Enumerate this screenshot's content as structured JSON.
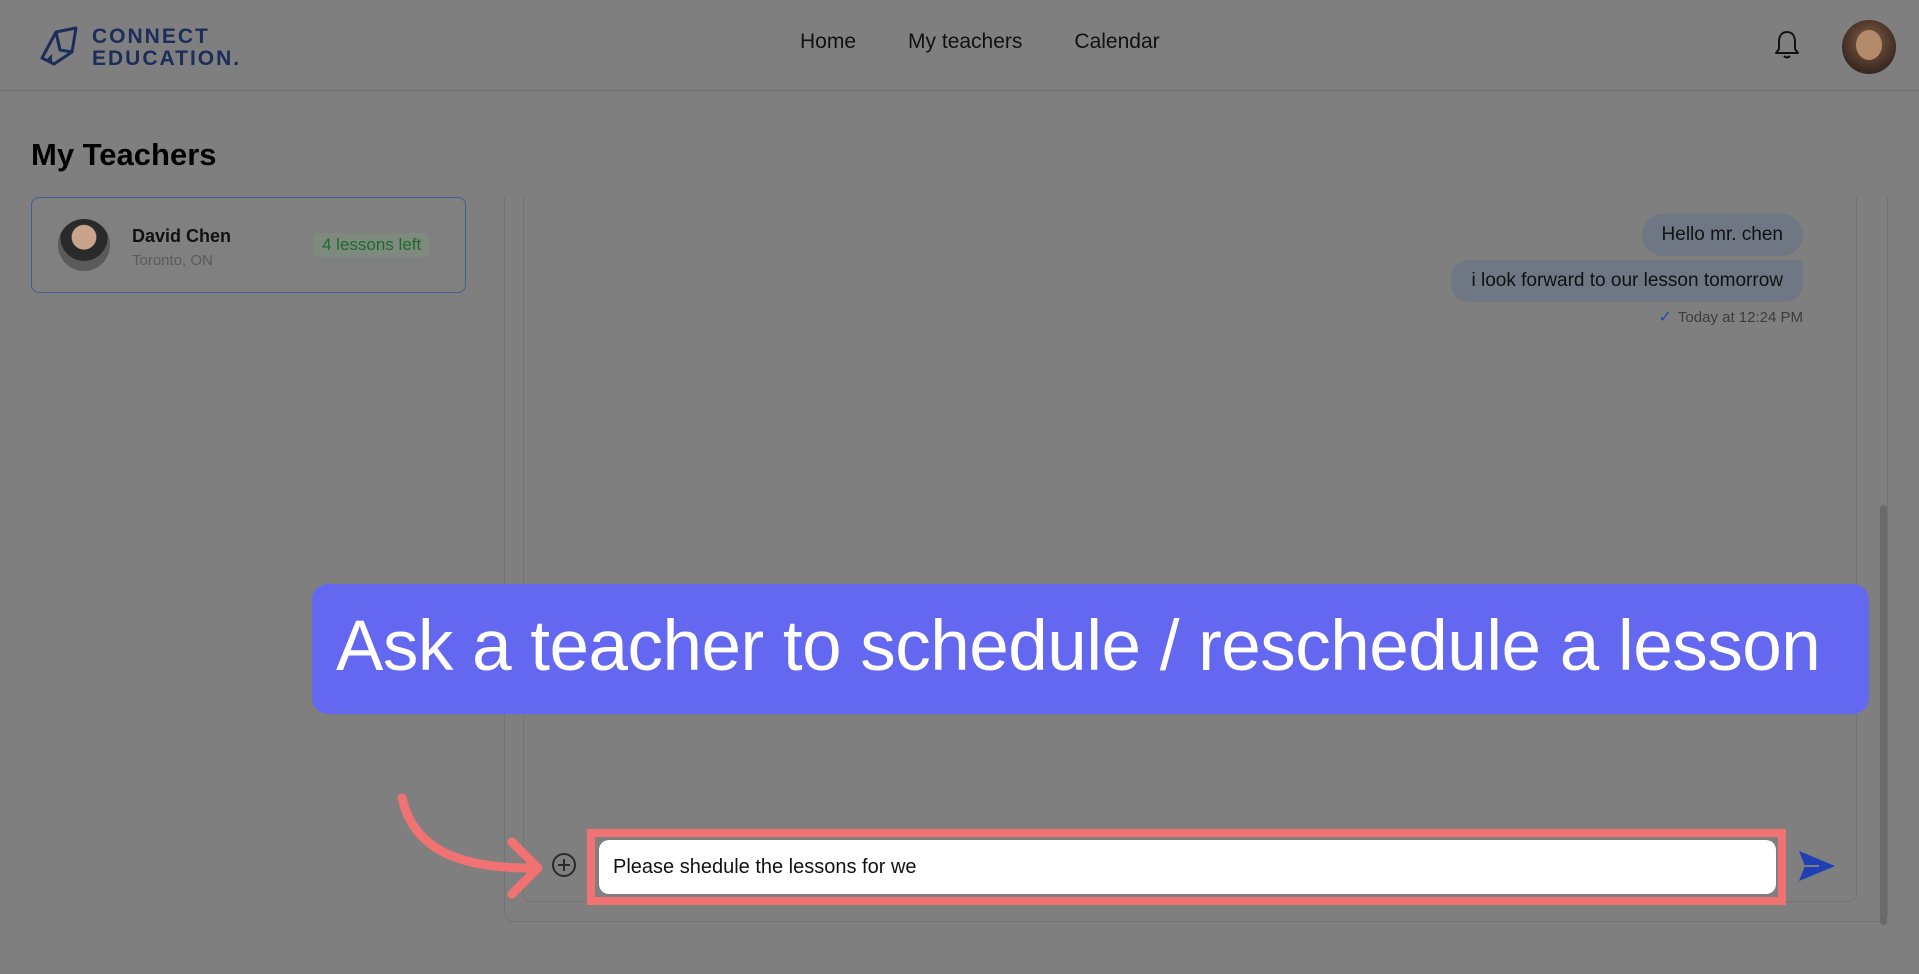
{
  "header": {
    "logo_line1": "CONNECT",
    "logo_line2": "EDUCATION.",
    "nav": [
      "Home",
      "My teachers",
      "Calendar"
    ],
    "icons": [
      "bell-icon",
      "user-avatar"
    ]
  },
  "page": {
    "title": "My Teachers"
  },
  "teachers": [
    {
      "name": "David Chen",
      "location": "Toronto, ON",
      "lessons": "4 lessons left"
    }
  ],
  "chat": {
    "messages": [
      "Hello mr. chen",
      "i look forward to our lesson tomorrow"
    ],
    "timestamp": "Today at 12:24 PM",
    "input_value": "Please shedule the lessons for we"
  },
  "overlay": {
    "banner_text": "Ask a teacher to schedule / reschedule a lesson"
  },
  "colors": {
    "banner": "#6467ef",
    "highlight": "#f07272",
    "send": "#1f3fb5"
  }
}
